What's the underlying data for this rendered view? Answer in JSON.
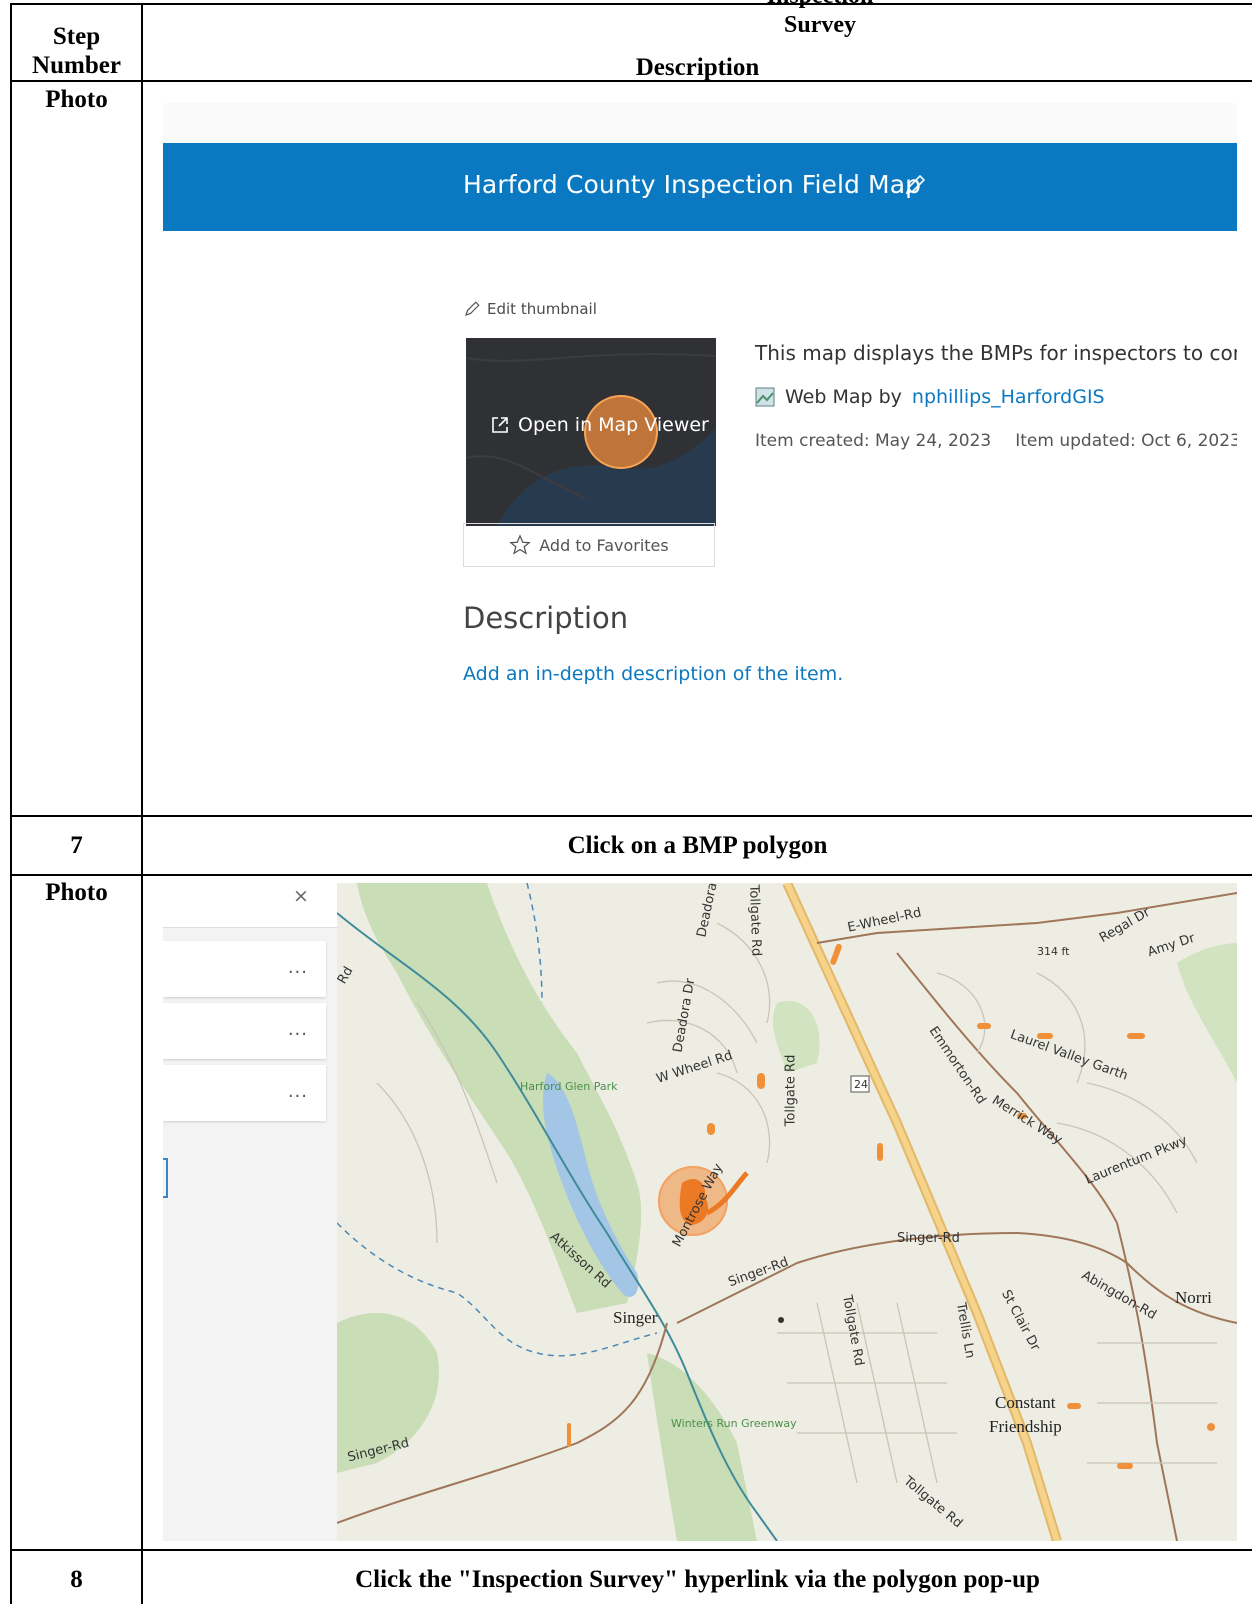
{
  "table": {
    "header_partial": "…Inspection Survey",
    "col_step_header": "Step Number",
    "col_desc_header": "Description",
    "rows": [
      {
        "step": "Photo",
        "desc": ""
      },
      {
        "step": "7",
        "desc": "Click on a BMP polygon"
      },
      {
        "step": "Photo",
        "desc": ""
      },
      {
        "step": "8",
        "desc": "Click the \"Inspection Survey\" hyperlink via the polygon pop-up"
      }
    ]
  },
  "screenshot_item_page": {
    "banner_title": "Harford County Inspection Field Map",
    "edit_thumbnail": "Edit thumbnail",
    "open_map_viewer": "Open in Map Viewer",
    "add_favorites": "Add to Favorites",
    "summary": "This map displays the BMPs for inspectors to complet",
    "owner_prefix": "Web Map by",
    "owner": "nphillips_HarfordGIS",
    "created": "Item created: May 24, 2023",
    "updated": "Item updated: Oct 6, 2023",
    "description_heading": "Description",
    "description_link": "Add an in-depth description of the item.",
    "banner_color": "#0a79c2",
    "highlight_color": "#f08c3c"
  },
  "screenshot_map": {
    "close_symbol": "×",
    "menu_dots": "...",
    "labels": {
      "e_wheel": "E-Wheel-Rd",
      "regal": "Regal Dr",
      "amy": "Amy Dr",
      "elev": "314 ft",
      "deadora1": "Deadora Dr",
      "deadora2": "Deadora Dr",
      "tollgate_top": "Tollgate Rd",
      "w_wheel": "W Wheel Rd",
      "tollgate_mid": "Tollgate Rd",
      "route": "24",
      "emmorton": "Emmorton-Rd",
      "laurel": "Laurel Valley Garth",
      "merrick": "Merrick Way",
      "laurentum": "Laurentum Pkwy",
      "park": "Harford Glen Park",
      "montrose1": "Montrose Way",
      "singer_rd_e": "Singer-Rd",
      "singer_rd_c": "Singer-Rd",
      "atkisson": "Atkisson Rd",
      "singer": "Singer",
      "tollgate_low": "Tollgate Rd",
      "trellis": "Trellis Ln",
      "stclair": "St Clair Dr",
      "abingdon": "Abingdon-Rd",
      "norri": "Norri",
      "constant": "Constant",
      "friendship": "Friendship",
      "winters": "Winters Run Greenway",
      "singer_rd_w": "Singer-Rd",
      "tollgate_bot": "Tollgate Rd",
      "rd_left": "Rd"
    }
  }
}
